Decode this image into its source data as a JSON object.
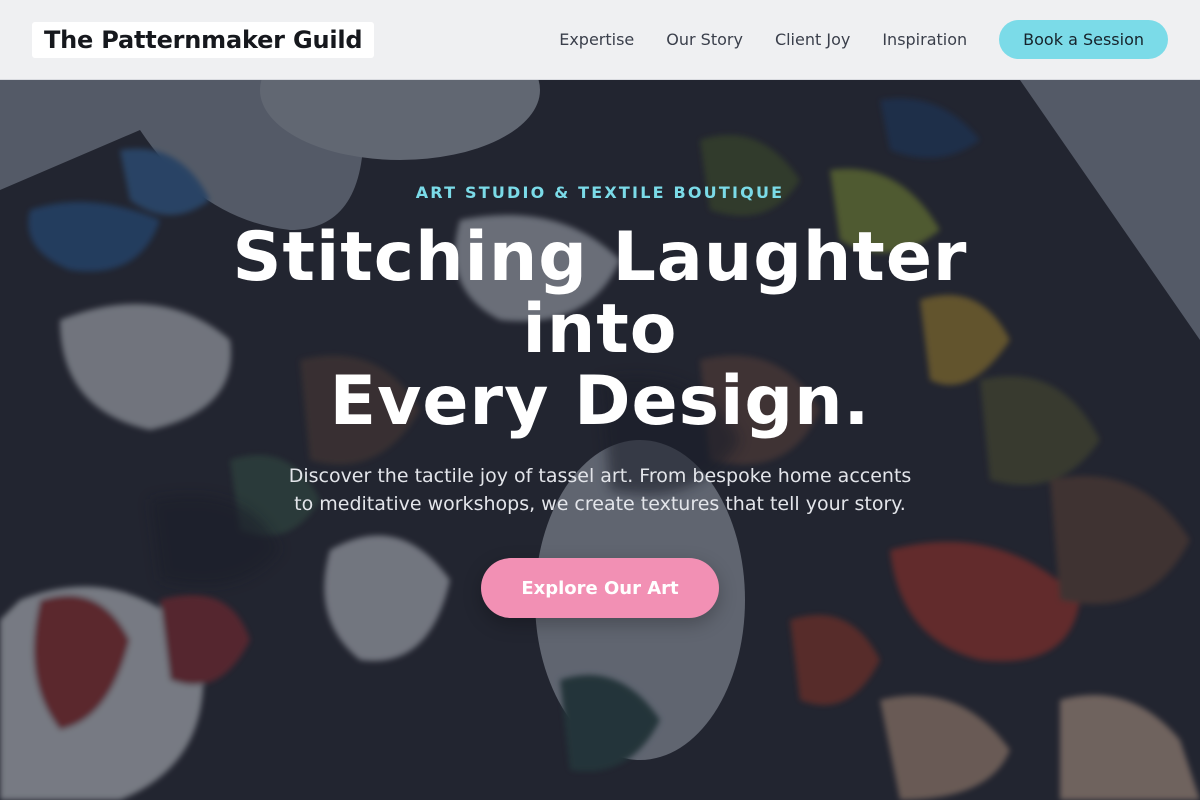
{
  "header": {
    "brand": "The Patternmaker Guild",
    "nav": [
      "Expertise",
      "Our Story",
      "Client Joy",
      "Inspiration"
    ],
    "cta_label": "Book a Session"
  },
  "hero": {
    "eyebrow": "ART STUDIO & TEXTILE BOUTIQUE",
    "headline_lines": [
      "Stitching Laughter",
      "into",
      "Every Design."
    ],
    "subtext_lines": [
      "Discover the tactile joy of tassel art. From bespoke home accents",
      "to meditative workshops, we create textures that tell your story."
    ],
    "cta_label": "Explore Our Art"
  },
  "colors": {
    "accent_cyan": "#7bdbe8",
    "accent_pink": "#f290b4",
    "header_bg": "#eff0f2"
  }
}
